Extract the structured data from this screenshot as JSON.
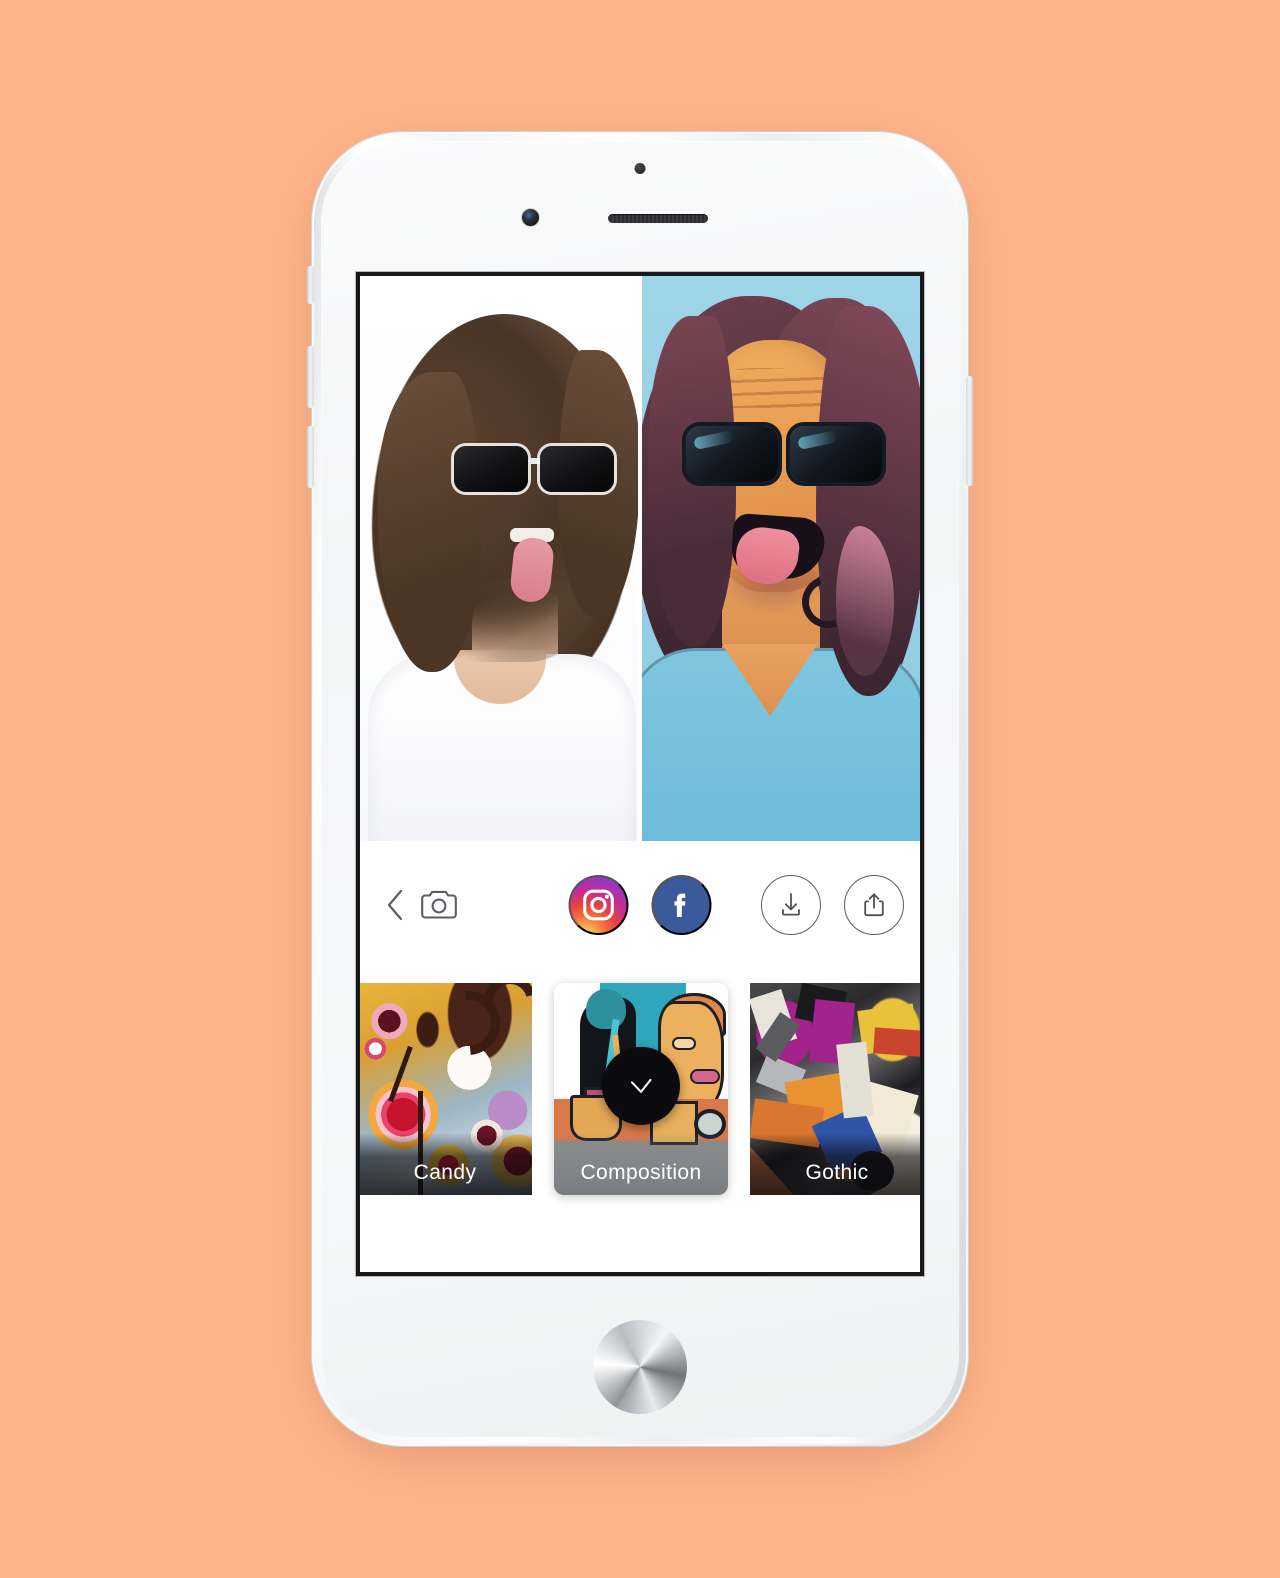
{
  "background_color": "#FFB489",
  "device": {
    "name": "iphone-white",
    "body_color": "#f5f6f7",
    "buttons": [
      "silent-switch",
      "volume-up",
      "volume-down",
      "power-button"
    ],
    "home_button": "home-button"
  },
  "app": {
    "name": "photo-art-filter",
    "photo": {
      "type": "before-after-split",
      "original_label": "original-photo",
      "filtered_label": "filtered-photo",
      "original_background": "#ffffff",
      "filtered_background": "#96cfe4",
      "subject": "man-with-sunglasses-tongue-out"
    },
    "toolbar": {
      "back_label": "back-chevron",
      "camera_label": "camera",
      "instagram_label": "Instagram",
      "instagram_color": "#c92d8c",
      "facebook_label": "f",
      "facebook_color": "#3b5a9b",
      "download_label": "download",
      "share_label": "share"
    },
    "filters": {
      "selected_index": 1,
      "items": [
        {
          "label": "Candy",
          "selected": false
        },
        {
          "label": "Composition",
          "selected": true
        },
        {
          "label": "Gothic",
          "selected": false
        }
      ],
      "check_glyph": "check"
    }
  }
}
